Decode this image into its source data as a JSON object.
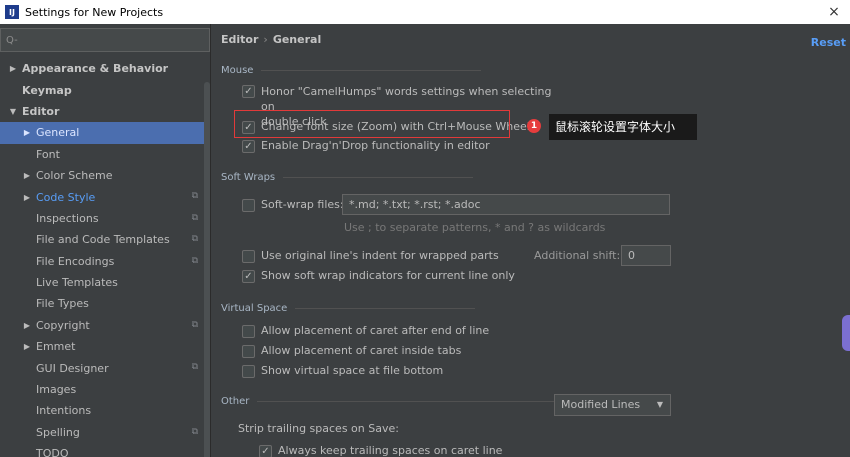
{
  "window": {
    "title": "Settings for New Projects",
    "app_icon_text": "IJ",
    "close_glyph": "×"
  },
  "sidebar": {
    "search_placeholder": "Q-",
    "items": [
      {
        "label": "Appearance & Behavior",
        "arrow": "▶",
        "bold": true,
        "indent": 0
      },
      {
        "label": "Keymap",
        "arrow": "",
        "bold": true,
        "indent": 0
      },
      {
        "label": "Editor",
        "arrow": "▼",
        "bold": true,
        "indent": 0
      },
      {
        "label": "General",
        "arrow": "▶",
        "selected": true,
        "indent": 1
      },
      {
        "label": "Font",
        "arrow": "",
        "indent": 1
      },
      {
        "label": "Color Scheme",
        "arrow": "▶",
        "indent": 1
      },
      {
        "label": "Code Style",
        "arrow": "▶",
        "link": true,
        "indent": 1,
        "icon": true
      },
      {
        "label": "Inspections",
        "arrow": "",
        "indent": 1,
        "icon": true
      },
      {
        "label": "File and Code Templates",
        "arrow": "",
        "indent": 1,
        "icon": true
      },
      {
        "label": "File Encodings",
        "arrow": "",
        "indent": 1,
        "icon": true
      },
      {
        "label": "Live Templates",
        "arrow": "",
        "indent": 1
      },
      {
        "label": "File Types",
        "arrow": "",
        "indent": 1
      },
      {
        "label": "Copyright",
        "arrow": "▶",
        "indent": 1,
        "icon": true
      },
      {
        "label": "Emmet",
        "arrow": "▶",
        "indent": 1
      },
      {
        "label": "GUI Designer",
        "arrow": "",
        "indent": 1,
        "icon": true
      },
      {
        "label": "Images",
        "arrow": "",
        "indent": 1
      },
      {
        "label": "Intentions",
        "arrow": "",
        "indent": 1
      },
      {
        "label": "Spelling",
        "arrow": "",
        "indent": 1,
        "icon": true
      },
      {
        "label": "TODO",
        "arrow": "",
        "indent": 1
      }
    ]
  },
  "main": {
    "breadcrumb": {
      "part1": "Editor",
      "sep": "›",
      "part2": "General"
    },
    "reset_label": "Reset",
    "mouse": {
      "title": "Mouse",
      "camelhumps_line1": "Honor \"CamelHumps\" words settings when selecting on",
      "camelhumps_line2": "double click",
      "font_zoom": "Change font size (Zoom) with Ctrl+Mouse Wheel",
      "drag_drop": "Enable Drag'n'Drop functionality in editor"
    },
    "annotation": {
      "number": "1",
      "text": "鼠标滚轮设置字体大小"
    },
    "soft_wraps": {
      "title": "Soft Wraps",
      "softwrap_label": "Soft-wrap files:",
      "softwrap_value": "*.md; *.txt; *.rst; *.adoc",
      "softwrap_hint": "Use ; to separate patterns, * and ? as wildcards",
      "original_indent": "Use original line's indent for wrapped parts",
      "additional_shift_label": "Additional shift:",
      "additional_shift_value": "0",
      "show_indicators": "Show soft wrap indicators for current line only"
    },
    "virtual_space": {
      "title": "Virtual Space",
      "after_eol": "Allow placement of caret after end of line",
      "inside_tabs": "Allow placement of caret inside tabs",
      "show_bottom": "Show virtual space at file bottom"
    },
    "other": {
      "title": "Other",
      "strip_label": "Strip trailing spaces on Save:",
      "strip_value": "Modified Lines",
      "keep_trailing": "Always keep trailing spaces on caret line"
    },
    "check_glyph": "✓",
    "caret_glyph": "▼"
  }
}
